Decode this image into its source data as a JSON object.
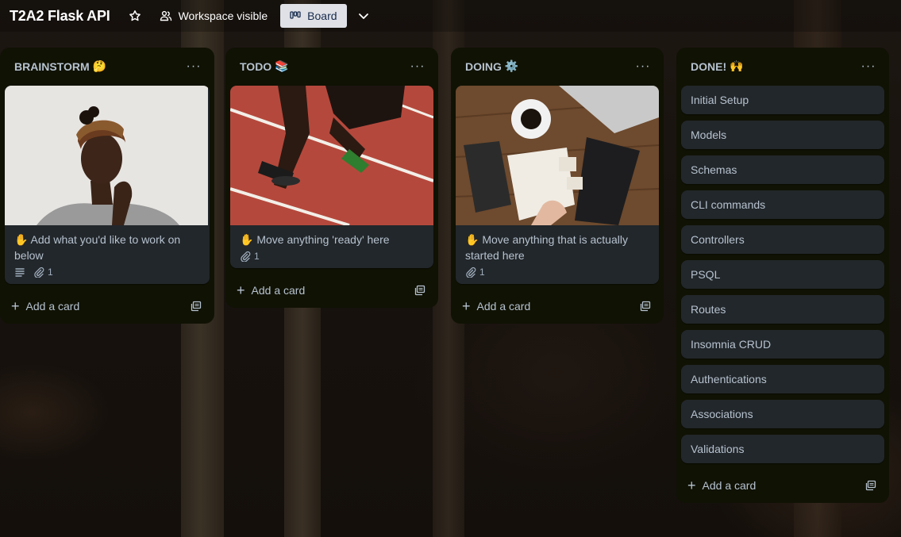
{
  "header": {
    "board_title": "T2A2 Flask API",
    "visibility_label": "Workspace visible",
    "view_label": "Board"
  },
  "lists": [
    {
      "title": "BRAINSTORM",
      "emoji": "🤔",
      "card": {
        "title": "✋ Add what you'd like to work on below",
        "attachments": "1",
        "has_description": true,
        "cover": "woman-thinking"
      },
      "add_label": "Add a card"
    },
    {
      "title": "TODO",
      "emoji": "📚",
      "card": {
        "title": "✋ Move anything 'ready' here",
        "attachments": "1",
        "cover": "sprinter-on-track"
      },
      "add_label": "Add a card"
    },
    {
      "title": "DOING",
      "emoji": "⚙️",
      "card": {
        "title": "✋ Move anything that is actually started here",
        "attachments": "1",
        "cover": "desk-with-coffee"
      },
      "add_label": "Add a card"
    },
    {
      "title": "DONE!",
      "emoji": "🙌",
      "cards": [
        "Initial Setup",
        "Models",
        "Schemas",
        "CLI commands",
        "Controllers",
        "PSQL",
        "Routes",
        "Insomnia CRUD",
        "Authentications",
        "Associations",
        "Validations"
      ],
      "add_label": "Add a card"
    }
  ],
  "colors": {
    "list_bg": "#101204",
    "card_bg": "#22272b",
    "text": "#b6c2cf",
    "board_button_bg": "#dfe1e6"
  }
}
